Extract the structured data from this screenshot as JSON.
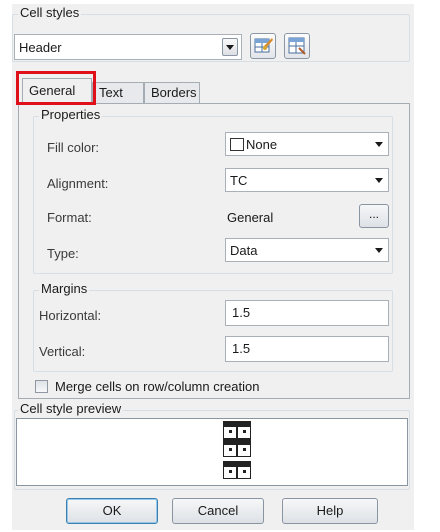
{
  "cell_styles": {
    "group_label": "Cell styles",
    "selected_style": "Header"
  },
  "tabs": [
    {
      "label": "General",
      "active": true
    },
    {
      "label": "Text",
      "active": false
    },
    {
      "label": "Borders",
      "active": false
    }
  ],
  "properties": {
    "group_label": "Properties",
    "fill_color_label": "Fill color:",
    "fill_color_value": "None",
    "alignment_label": "Alignment:",
    "alignment_value": "TC",
    "format_label": "Format:",
    "format_value": "General",
    "format_button": "...",
    "type_label": "Type:",
    "type_value": "Data"
  },
  "margins": {
    "group_label": "Margins",
    "horizontal_label": "Horizontal:",
    "horizontal_value": "1.5",
    "vertical_label": "Vertical:",
    "vertical_value": "1.5"
  },
  "merge_checkbox": {
    "label": "Merge cells on row/column creation",
    "checked": false
  },
  "preview": {
    "group_label": "Cell style preview"
  },
  "buttons": {
    "ok": "OK",
    "cancel": "Cancel",
    "help": "Help"
  },
  "colors": {
    "highlight": "#e0101a",
    "dialog_bg": "#f0f0f0"
  }
}
